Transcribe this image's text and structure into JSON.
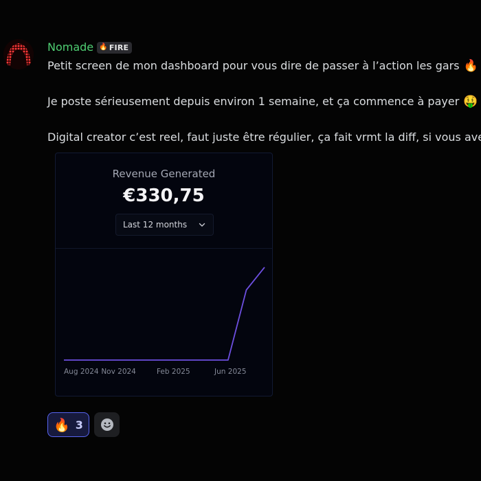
{
  "message": {
    "author": "Nomade",
    "author_color": "#4fcf73",
    "role_tag": {
      "icon": "fire-icon",
      "label": "FIRE"
    },
    "lines": [
      {
        "text": "Petit screen de mon dashboard pour vous dire de passer à l’action les gars",
        "emoji": "🔥"
      },
      {
        "text": "Je poste sérieusement depuis environ 1 semaine, et ça commence à payer",
        "emoji": "🤑"
      },
      {
        "text": "Digital creator c’est reel, faut juste être régulier, ça fait vrmt la diff, si vous ave",
        "emoji": ""
      }
    ]
  },
  "dashboard": {
    "title": "Revenue Generated",
    "amount": "€330,75",
    "period": "Last 12 months",
    "accent": "#6d4fe0"
  },
  "chart_data": {
    "type": "line",
    "x_ticks": [
      "Aug 2024",
      "Nov 2024",
      "Feb 2025",
      "Jun 2025"
    ],
    "x": [
      "Aug 2024",
      "Sep 2024",
      "Oct 2024",
      "Nov 2024",
      "Dec 2024",
      "Jan 2025",
      "Feb 2025",
      "Mar 2025",
      "Apr 2025",
      "May 2025",
      "Jun 2025",
      "Jul 2025"
    ],
    "y": [
      0,
      0,
      0,
      0,
      0,
      0,
      0,
      0,
      0,
      0,
      250,
      330.75
    ],
    "ylim": [
      0,
      330.75
    ],
    "grid": false,
    "title": "",
    "xlabel": "",
    "ylabel": ""
  },
  "reactions": [
    {
      "emoji": "🔥",
      "count": "3",
      "active": true
    }
  ],
  "add_reaction_icon": "add-reaction-smiley-icon"
}
